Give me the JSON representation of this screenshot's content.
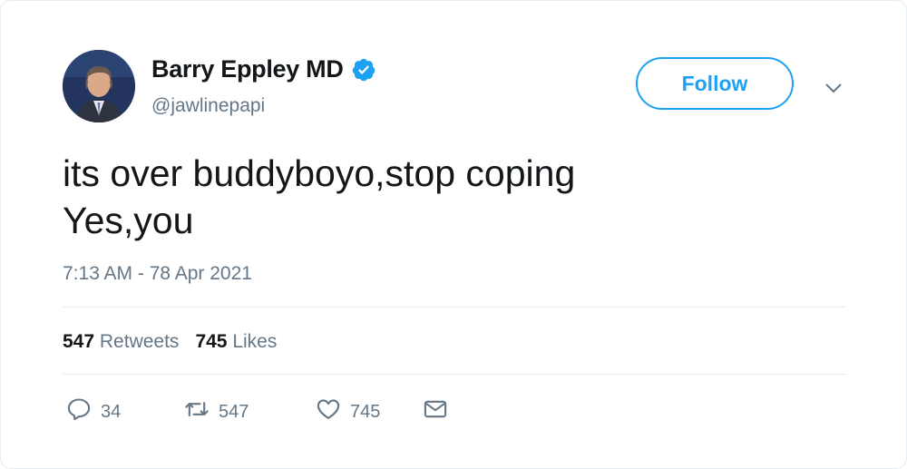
{
  "author": {
    "display_name": "Barry Eppley MD",
    "handle": "@jawlinepapi",
    "verified": true,
    "avatar_icon": "profile-photo"
  },
  "follow_button": {
    "label": "Follow"
  },
  "menu": {
    "icon": "chevron-down-icon"
  },
  "tweet": {
    "text": "its over buddyboyo,stop coping\nYes,you",
    "timestamp": "7:13 AM - 78 Apr 2021"
  },
  "stats": {
    "retweets_count": "547",
    "retweets_label": "Retweets",
    "likes_count": "745",
    "likes_label": "Likes"
  },
  "actions": {
    "reply_count": "34",
    "retweet_count": "547",
    "like_count": "745"
  },
  "colors": {
    "accent": "#1da1f2",
    "text_primary": "#14171a",
    "text_secondary": "#657786",
    "divider": "#e6ecf0"
  }
}
